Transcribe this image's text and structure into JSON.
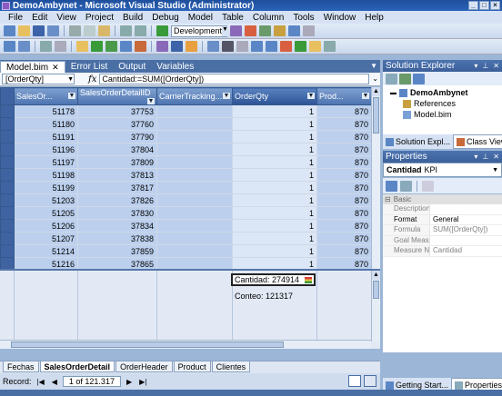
{
  "window": {
    "title": "DemoAmbynet - Microsoft Visual Studio (Administrator)"
  },
  "menu": [
    "File",
    "Edit",
    "View",
    "Project",
    "Build",
    "Debug",
    "Model",
    "Table",
    "Column",
    "Tools",
    "Window",
    "Help"
  ],
  "toolbar": {
    "configuration": "Development"
  },
  "doc_tabs": [
    "Model.bim",
    "Error List",
    "Output",
    "Variables"
  ],
  "formula_bar": {
    "measure": "[OrderQty]",
    "fx": "fx",
    "formula": "Cantidad:=SUM([OrderQty])"
  },
  "grid": {
    "columns": [
      "SalesOr...",
      "SalesOrderDetailID",
      "CarrierTracking...",
      "OrderQty",
      "Prod..."
    ],
    "rows": [
      [
        "51178",
        "37753",
        "",
        "1",
        "870"
      ],
      [
        "51180",
        "37760",
        "",
        "1",
        "870"
      ],
      [
        "51191",
        "37790",
        "",
        "1",
        "870"
      ],
      [
        "51196",
        "37804",
        "",
        "1",
        "870"
      ],
      [
        "51197",
        "37809",
        "",
        "1",
        "870"
      ],
      [
        "51198",
        "37813",
        "",
        "1",
        "870"
      ],
      [
        "51199",
        "37817",
        "",
        "1",
        "870"
      ],
      [
        "51203",
        "37826",
        "",
        "1",
        "870"
      ],
      [
        "51205",
        "37830",
        "",
        "1",
        "870"
      ],
      [
        "51206",
        "37834",
        "",
        "1",
        "870"
      ],
      [
        "51207",
        "37838",
        "",
        "1",
        "870"
      ],
      [
        "51214",
        "37859",
        "",
        "1",
        "870"
      ],
      [
        "51216",
        "37865",
        "",
        "1",
        "870"
      ]
    ]
  },
  "calc": {
    "cantidad": "Cantidad: 274914",
    "conteo": "Conteo: 121317"
  },
  "sheet_tabs": [
    "Fechas",
    "SalesOrderDetail",
    "OrderHeader",
    "Product",
    "Clientes"
  ],
  "record": {
    "label": "Record:",
    "position": "1 of 121.317"
  },
  "solution_explorer": {
    "title": "Solution Explorer",
    "project": "DemoAmbynet",
    "items": [
      "References",
      "Model.bim"
    ],
    "tabs": [
      "Solution Expl...",
      "Class View"
    ]
  },
  "properties": {
    "title": "Properties",
    "object_name": "Cantidad",
    "object_type": "KPI",
    "category": "Basic",
    "rows": [
      {
        "name": "Description",
        "value": ""
      },
      {
        "name": "Format",
        "value": "General"
      },
      {
        "name": "Formula",
        "value": "SUM([OrderQty])"
      },
      {
        "name": "Goal Measure",
        "value": ""
      },
      {
        "name": "Measure Name",
        "value": "Cantidad"
      }
    ]
  },
  "bottom_tabs": [
    "Getting Start...",
    "Properties"
  ]
}
